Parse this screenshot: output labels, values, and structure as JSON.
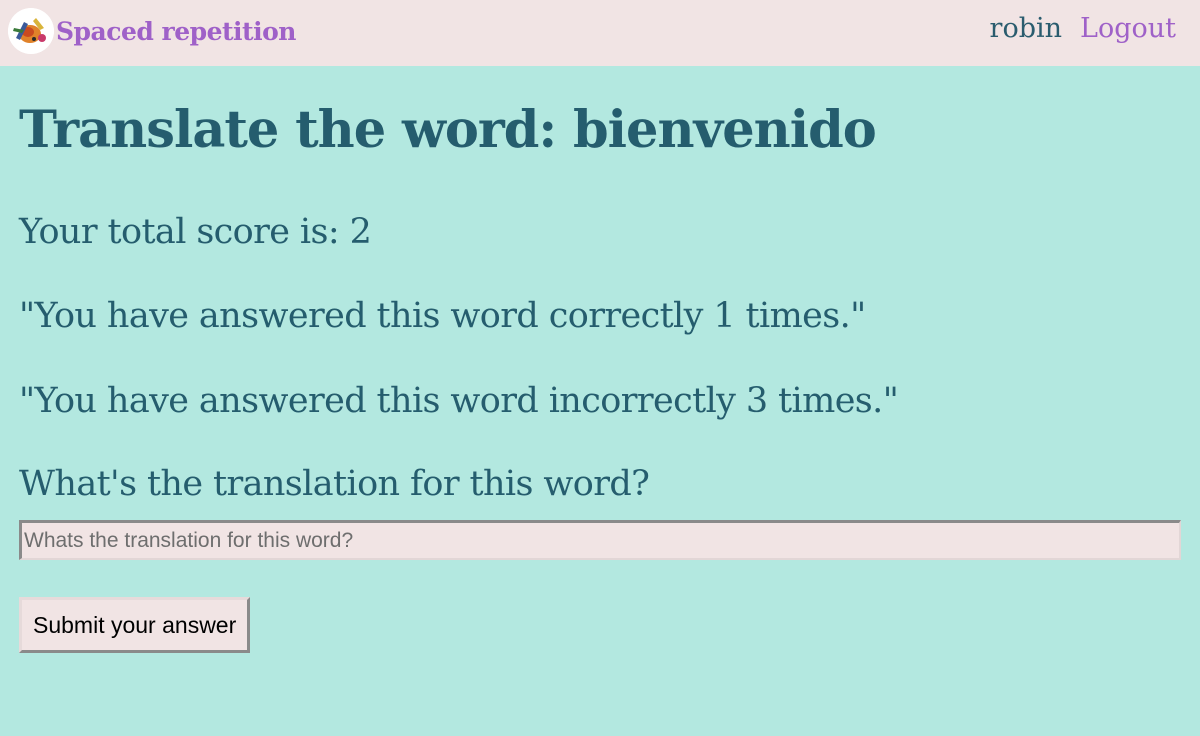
{
  "header": {
    "app_title": "Spaced repetition",
    "username": "robin",
    "logout_label": "Logout"
  },
  "main": {
    "title": "Translate the word: bienvenido",
    "score_text": "Your total score is: 2",
    "correct_text": "\"You have answered this word correctly 1 times.\"",
    "incorrect_text": "\"You have answered this word incorrectly 3 times.\"",
    "question_label": "What's the translation for this word?",
    "answer_input": {
      "value": "",
      "placeholder": "Whats the translation for this word?"
    },
    "submit_label": "Submit your answer"
  },
  "colors": {
    "background": "#b3e8e0",
    "header_background": "#f1e4e4",
    "brand": "#9f61c8",
    "text": "#255d6e"
  }
}
